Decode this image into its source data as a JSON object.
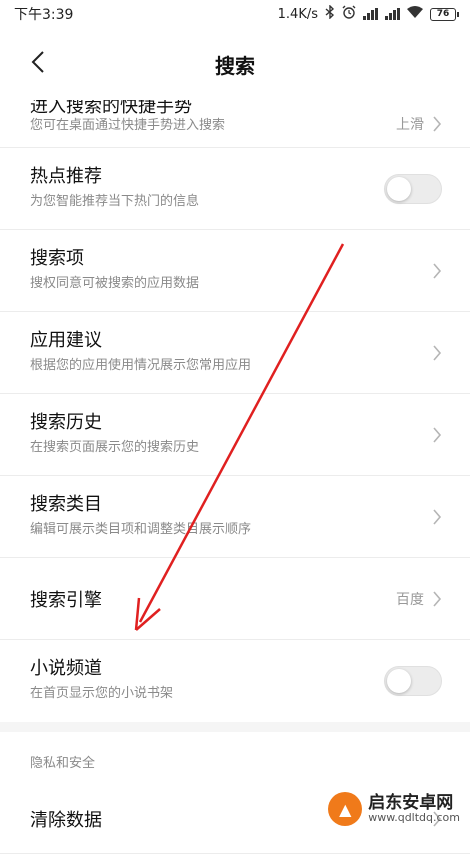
{
  "status": {
    "time": "下午3:39",
    "speed": "1.4K/s",
    "battery": "76"
  },
  "header": {
    "title": "搜索"
  },
  "rows": [
    {
      "title": "进入搜索的快捷手势",
      "sub": "您可在桌面通过快捷手势进入搜索",
      "value": "上滑"
    },
    {
      "title": "热点推荐",
      "sub": "为您智能推荐当下热门的信息",
      "toggle": "off"
    },
    {
      "title": "搜索项",
      "sub": "搜权同意可被搜索的应用数据"
    },
    {
      "title": "应用建议",
      "sub": "根据您的应用使用情况展示您常用应用"
    },
    {
      "title": "搜索历史",
      "sub": "在搜索页面展示您的搜索历史"
    },
    {
      "title": "搜索类目",
      "sub": "编辑可展示类目项和调整类目展示顺序"
    },
    {
      "title": "搜索引擎",
      "value": "百度"
    },
    {
      "title": "小说频道",
      "sub": "在首页显示您的小说书架",
      "toggle": "off"
    }
  ],
  "privacy_section": {
    "header": "隐私和安全",
    "rows": [
      {
        "title": "清除数据"
      }
    ]
  },
  "watermark": {
    "name": "启东安卓网",
    "url": "www.qdltdq.com"
  },
  "colors": {
    "annotation_arrow": "#e02020",
    "watermark_logo": "#f07a1a"
  }
}
